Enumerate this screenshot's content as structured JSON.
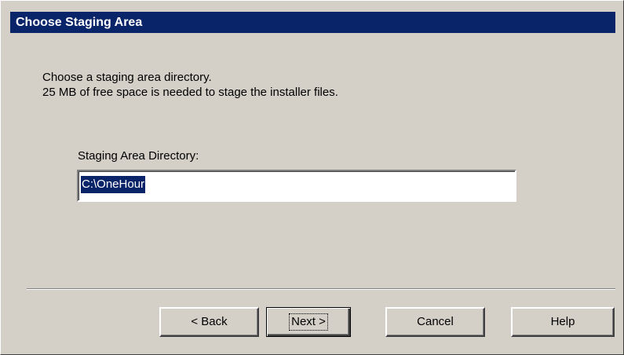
{
  "dialog": {
    "title": "Choose Staging Area",
    "message_line1": "Choose a staging area directory.",
    "message_line2": "25 MB of free space is needed to stage the installer files.",
    "directory_label": "Staging Area Directory:",
    "directory_value": "C:\\OneHour"
  },
  "buttons": {
    "back": "< Back",
    "next": "Next >",
    "cancel": "Cancel",
    "help": "Help"
  },
  "colors": {
    "titlebar": "#0a246a",
    "dialog_face": "#d4d0c8",
    "selection": "#0a246a"
  }
}
